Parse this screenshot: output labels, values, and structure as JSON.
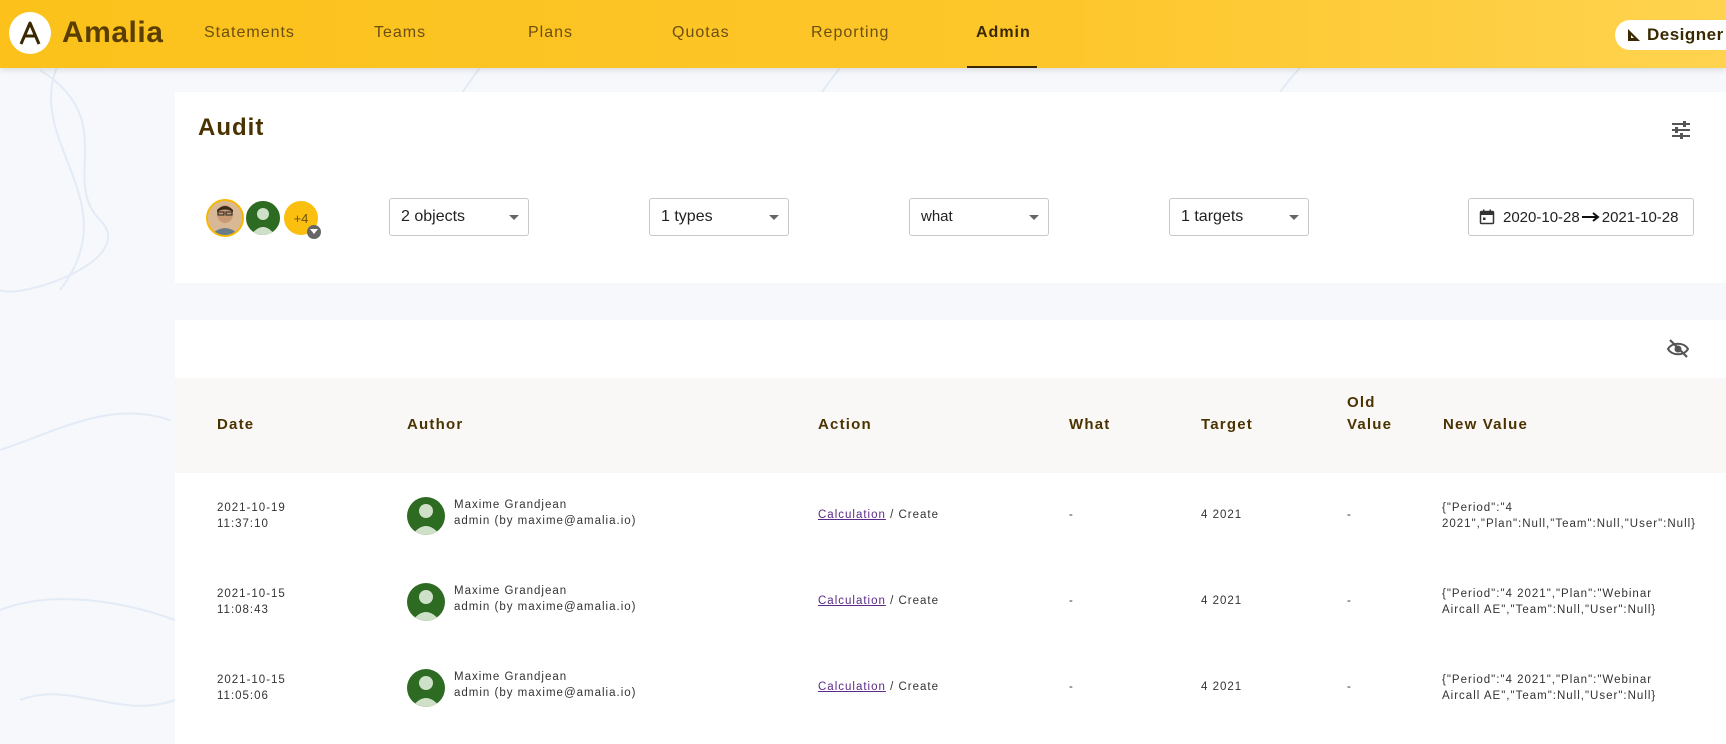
{
  "app": {
    "logo_letter": "A",
    "name": "Amalia",
    "brand_color": "#fcc21b"
  },
  "nav": {
    "items": [
      {
        "label": "Statements"
      },
      {
        "label": "Teams"
      },
      {
        "label": "Plans"
      },
      {
        "label": "Quotas"
      },
      {
        "label": "Reporting"
      },
      {
        "label": "Admin",
        "active": true
      }
    ],
    "designer_label": "Designer",
    "designer_icon": "set-square-icon"
  },
  "audit": {
    "title": "Audit",
    "filter_icon": "tune-sliders-icon",
    "avatars_more": "+4",
    "filters": {
      "objects": "2 objects",
      "types": "1 types",
      "what": "what",
      "targets": "1 targets"
    },
    "date_range": {
      "icon": "calendar-icon",
      "start": "2020-10-28",
      "end": "2021-10-28"
    }
  },
  "table": {
    "visibility_icon": "eye-off-icon",
    "columns": {
      "date": "Date",
      "author": "Author",
      "action": "Action",
      "what": "What",
      "target": "Target",
      "old_value_1": "Old",
      "old_value_2": "Value",
      "new_value": "New Value"
    },
    "rows": [
      {
        "date": "2021-10-19",
        "time": "11:37:10",
        "author_name": "Maxime Grandjean",
        "author_role": "admin (by maxime@amalia.io)",
        "action_link": "Calculation",
        "action_rest": " / Create",
        "what": "-",
        "target": "4 2021",
        "old_value": "-",
        "new_value_1": "{\"Period\":\"4",
        "new_value_2": "2021\",\"Plan\":Null,\"Team\":Null,\"User\":Null}"
      },
      {
        "date": "2021-10-15",
        "time": "11:08:43",
        "author_name": "Maxime Grandjean",
        "author_role": "admin (by maxime@amalia.io)",
        "action_link": "Calculation",
        "action_rest": " / Create",
        "what": "-",
        "target": "4 2021",
        "old_value": "-",
        "new_value_1": "{\"Period\":\"4 2021\",\"Plan\":\"Webinar",
        "new_value_2": "Aircall AE\",\"Team\":Null,\"User\":Null}"
      },
      {
        "date": "2021-10-15",
        "time": "11:05:06",
        "author_name": "Maxime Grandjean",
        "author_role": "admin (by maxime@amalia.io)",
        "action_link": "Calculation",
        "action_rest": " / Create",
        "what": "-",
        "target": "4 2021",
        "old_value": "-",
        "new_value_1": "{\"Period\":\"4 2021\",\"Plan\":\"Webinar",
        "new_value_2": "Aircall AE\",\"Team\":Null,\"User\":Null}"
      }
    ]
  }
}
